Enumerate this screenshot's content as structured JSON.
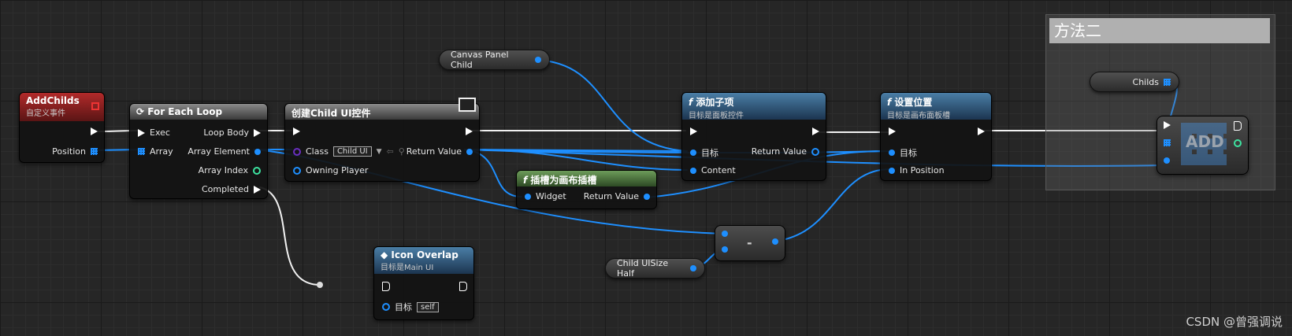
{
  "comment": {
    "title": "方法二"
  },
  "watermark": "CSDN @曾强调说",
  "nodes": {
    "addchilds": {
      "title": "AddChilds",
      "subtitle": "自定义事件",
      "pin_position": "Position"
    },
    "foreach": {
      "title": "For Each Loop",
      "exec": "Exec",
      "array": "Array",
      "loop_body": "Loop Body",
      "array_element": "Array Element",
      "array_index": "Array Index",
      "completed": "Completed"
    },
    "create": {
      "title": "创建Child UI控件",
      "class": "Class",
      "class_value": "Child UI",
      "owning_player": "Owning Player",
      "return_value": "Return Value"
    },
    "canvas_panel_child": {
      "label": "Canvas Panel Child"
    },
    "slot": {
      "title": "插槽为画布插槽",
      "widget": "Widget",
      "return_value": "Return Value"
    },
    "icon_overlay": {
      "title": "Icon Overlap",
      "subtitle": "目标是Main UI",
      "target": "目标",
      "self": "self"
    },
    "child_size_half": {
      "label": "Child UISize Half"
    },
    "subtract": {
      "label": "-"
    },
    "add_child": {
      "title": "添加子项",
      "subtitle": "目标是面板控件",
      "target": "目标",
      "content": "Content",
      "return_value": "Return Value"
    },
    "set_position": {
      "title": "设置位置",
      "subtitle": "目标是画布面板槽",
      "target": "目标",
      "in_position": "In Position"
    },
    "childs": {
      "label": "Childs"
    },
    "add": {
      "label": "ADD"
    }
  }
}
